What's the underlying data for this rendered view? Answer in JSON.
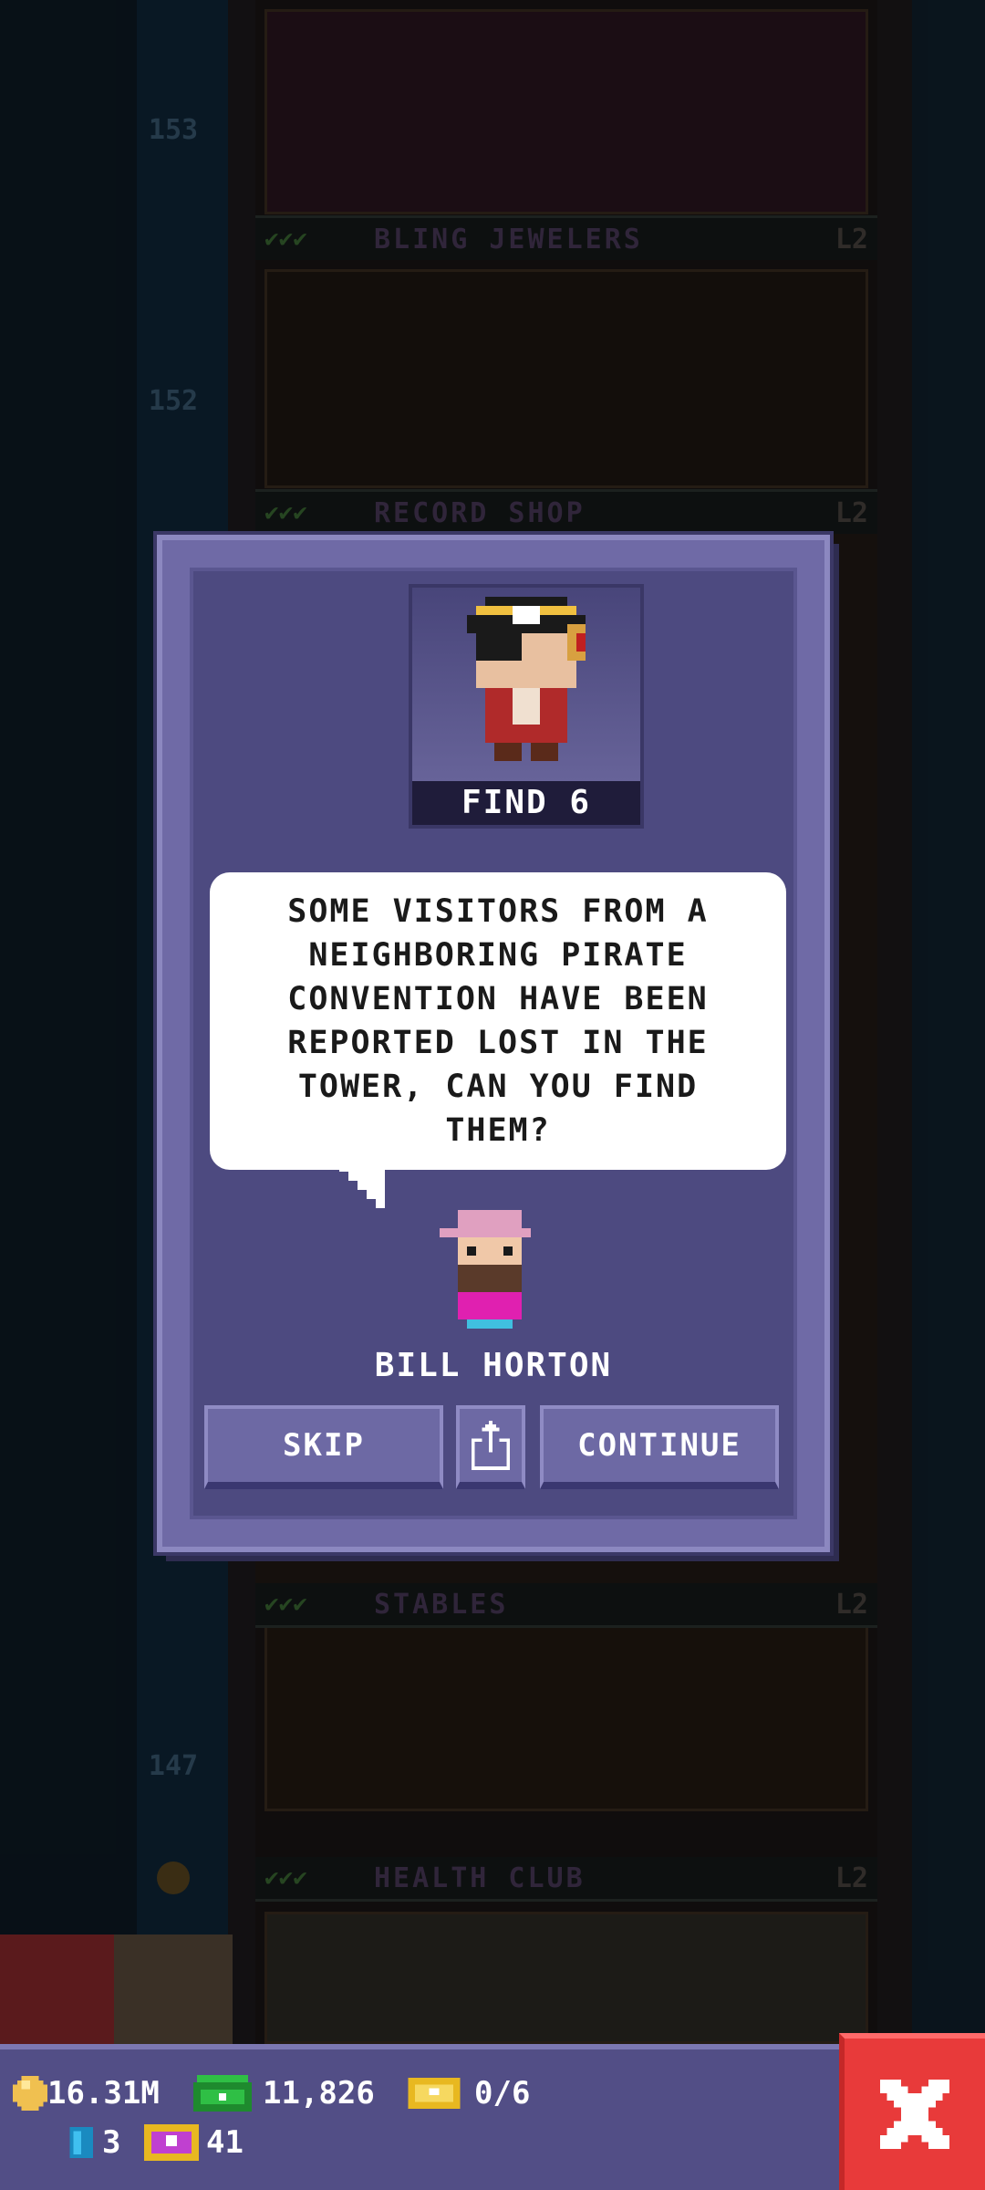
{
  "tower": {
    "floor_numbers": [
      "153",
      "152",
      "147"
    ],
    "floors": [
      {
        "name": "BLING JEWELERS",
        "level": "L2"
      },
      {
        "name": "RECORD SHOP",
        "level": "L2"
      },
      {
        "name": "STABLES",
        "level": "L2"
      },
      {
        "name": "HEALTH CLUB",
        "level": "L2"
      }
    ]
  },
  "mission": {
    "find_label": "FIND 6",
    "message": "SOME VISITORS FROM A NEIGHBORING PIRATE CONVENTION HAVE BEEN REPORTED LOST IN THE TOWER, CAN YOU FIND THEM?",
    "npc_name": "BILL HORTON",
    "skip_label": "SKIP",
    "continue_label": "CONTINUE",
    "share_icon": "share-icon"
  },
  "status_bar": {
    "coins": "16.31M",
    "bux": "11,826",
    "tickets": "0/6",
    "keys": "3",
    "vip": "41",
    "close_icon": "close-icon"
  },
  "colors": {
    "dialog": "#6f6aa6",
    "dialog_inner": "#4d4a80",
    "button": "#6d69a4",
    "close": "#e83a3a",
    "bar": "#524e86"
  }
}
